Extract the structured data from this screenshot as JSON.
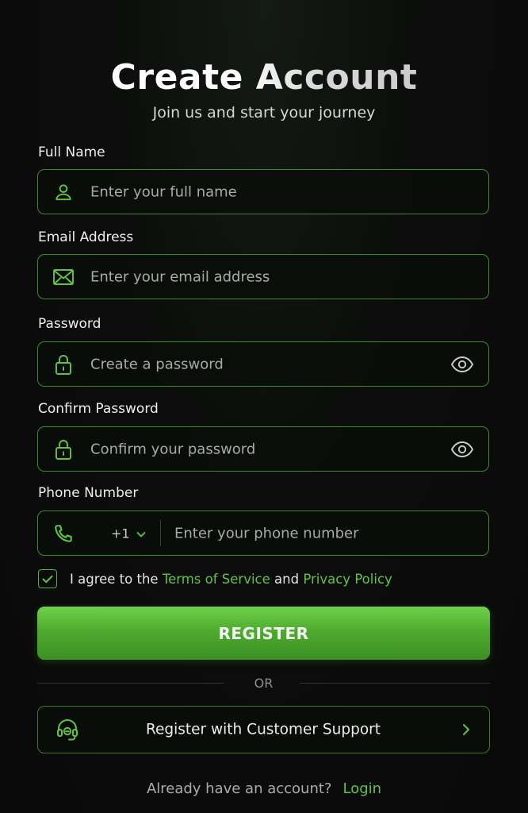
{
  "header": {
    "title": "Create Account",
    "subtitle": "Join us and start your journey"
  },
  "form": {
    "full_name": {
      "label": "Full Name",
      "placeholder": "Enter your full name",
      "icon": "user-icon"
    },
    "email": {
      "label": "Email Address",
      "placeholder": "Enter your email address",
      "icon": "envelope-icon"
    },
    "password": {
      "label": "Password",
      "placeholder": "Create a password",
      "icon": "lock-icon",
      "toggle_icon": "eye-icon"
    },
    "confirm_password": {
      "label": "Confirm Password",
      "placeholder": "Confirm your password",
      "icon": "lock-icon",
      "toggle_icon": "eye-icon"
    },
    "phone": {
      "label": "Phone Number",
      "country_code": "+1",
      "placeholder": "Enter your phone number",
      "icon": "phone-icon"
    },
    "agree": {
      "checked": true,
      "prefix": "I agree to the",
      "terms_link": "Terms of Service",
      "conjunction": "and",
      "privacy_link": "Privacy Policy"
    },
    "register_label": "REGISTER",
    "or_label": "OR",
    "support": {
      "label": "Register with Customer Support",
      "icon": "headset-icon"
    }
  },
  "footer": {
    "prompt": "Already have an account?",
    "login_label": "Login"
  },
  "colors": {
    "accent": "#5ec640",
    "border": "#3f8a2c",
    "background": "#0a0a0a"
  }
}
